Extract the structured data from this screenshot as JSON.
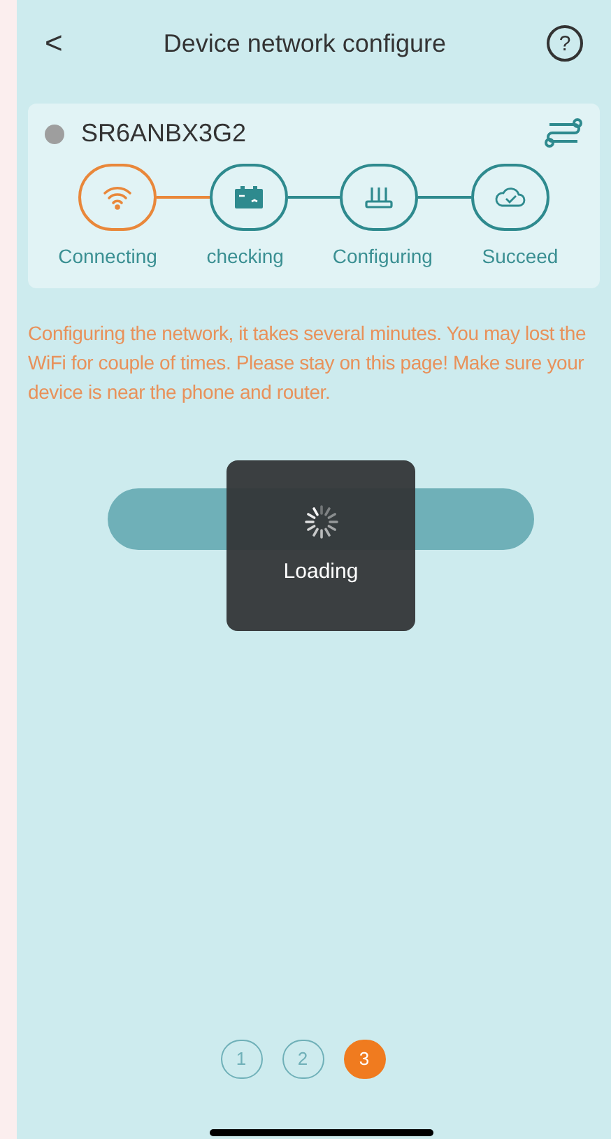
{
  "header": {
    "back": "<",
    "title": "Device network configure",
    "help": "?"
  },
  "device": {
    "name": "SR6ANBX3G2",
    "color": "#9e9e9e"
  },
  "steps": [
    {
      "label": "Connecting",
      "kind": "wifi",
      "selected": true
    },
    {
      "label": "checking",
      "kind": "battery",
      "selected": false
    },
    {
      "label": "Configuring",
      "kind": "router",
      "selected": false
    },
    {
      "label": "Succeed",
      "kind": "cloud",
      "selected": false
    }
  ],
  "message": "Configuring the network, it takes several minutes. You may lost the WiFi for couple of times. Please stay on this page! Make sure your device is near the phone and router.",
  "loading": {
    "text": "Loading"
  },
  "pages": [
    {
      "label": "1",
      "selected": false
    },
    {
      "label": "2",
      "selected": false
    },
    {
      "label": "3",
      "selected": true
    }
  ]
}
